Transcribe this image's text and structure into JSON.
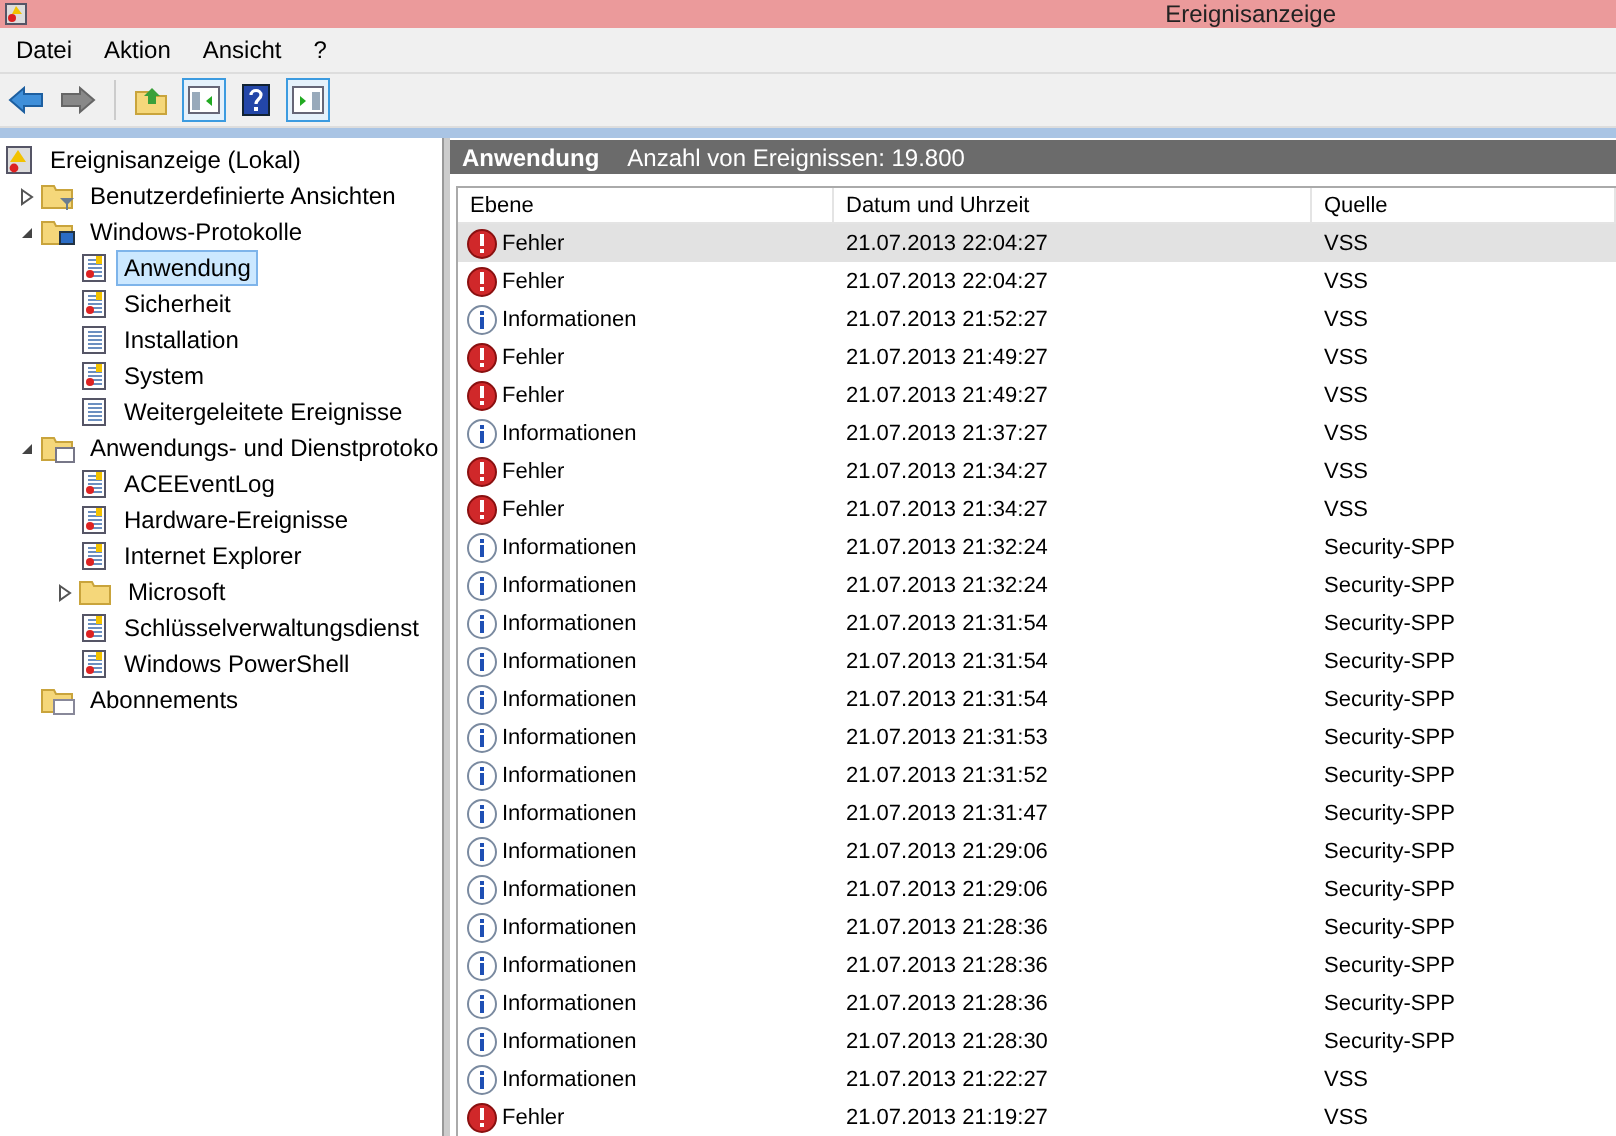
{
  "window": {
    "title": "Ereignisanzeige"
  },
  "menu": [
    "Datei",
    "Aktion",
    "Ansicht",
    "?"
  ],
  "tree": [
    {
      "label": "Ereignisanzeige (Lokal)",
      "kind": "root",
      "selected": false,
      "children": [
        {
          "label": "Benutzerdefinierte Ansichten",
          "kind": "filter-folder",
          "expanded": false,
          "selected": false
        },
        {
          "label": "Windows-Protokolle",
          "kind": "windows-folder",
          "expanded": true,
          "selected": false,
          "children": [
            {
              "label": "Anwendung",
              "kind": "log",
              "selected": true
            },
            {
              "label": "Sicherheit",
              "kind": "log",
              "selected": false
            },
            {
              "label": "Installation",
              "kind": "plain-log",
              "selected": false
            },
            {
              "label": "System",
              "kind": "log",
              "selected": false
            },
            {
              "label": "Weitergeleitete Ereignisse",
              "kind": "plain-log",
              "selected": false
            }
          ]
        },
        {
          "label": "Anwendungs- und Dienstprotoko",
          "kind": "app-folder",
          "expanded": true,
          "selected": false,
          "children": [
            {
              "label": "ACEEventLog",
              "kind": "log",
              "selected": false
            },
            {
              "label": "Hardware-Ereignisse",
              "kind": "log",
              "selected": false
            },
            {
              "label": "Internet Explorer",
              "kind": "log",
              "selected": false
            },
            {
              "label": "Microsoft",
              "kind": "folder",
              "expanded": false,
              "selected": false
            },
            {
              "label": "Schlüsselverwaltungsdienst",
              "kind": "log",
              "selected": false
            },
            {
              "label": "Windows PowerShell",
              "kind": "log",
              "selected": false
            }
          ]
        },
        {
          "label": "Abonnements",
          "kind": "subscriptions",
          "selected": false
        }
      ]
    }
  ],
  "panel": {
    "title": "Anwendung",
    "count": "Anzahl von Ereignissen: 19.800"
  },
  "table": {
    "columns": [
      "Ebene",
      "Datum und Uhrzeit",
      "Quelle"
    ],
    "rows": [
      {
        "kind": "error",
        "level": "Fehler",
        "date": "21.07.2013 22:04:27",
        "source": "VSS",
        "selected": true
      },
      {
        "kind": "error",
        "level": "Fehler",
        "date": "21.07.2013 22:04:27",
        "source": "VSS",
        "selected": false
      },
      {
        "kind": "info",
        "level": "Informationen",
        "date": "21.07.2013 21:52:27",
        "source": "VSS",
        "selected": false
      },
      {
        "kind": "error",
        "level": "Fehler",
        "date": "21.07.2013 21:49:27",
        "source": "VSS",
        "selected": false
      },
      {
        "kind": "error",
        "level": "Fehler",
        "date": "21.07.2013 21:49:27",
        "source": "VSS",
        "selected": false
      },
      {
        "kind": "info",
        "level": "Informationen",
        "date": "21.07.2013 21:37:27",
        "source": "VSS",
        "selected": false
      },
      {
        "kind": "error",
        "level": "Fehler",
        "date": "21.07.2013 21:34:27",
        "source": "VSS",
        "selected": false
      },
      {
        "kind": "error",
        "level": "Fehler",
        "date": "21.07.2013 21:34:27",
        "source": "VSS",
        "selected": false
      },
      {
        "kind": "info",
        "level": "Informationen",
        "date": "21.07.2013 21:32:24",
        "source": "Security-SPP",
        "selected": false
      },
      {
        "kind": "info",
        "level": "Informationen",
        "date": "21.07.2013 21:32:24",
        "source": "Security-SPP",
        "selected": false
      },
      {
        "kind": "info",
        "level": "Informationen",
        "date": "21.07.2013 21:31:54",
        "source": "Security-SPP",
        "selected": false
      },
      {
        "kind": "info",
        "level": "Informationen",
        "date": "21.07.2013 21:31:54",
        "source": "Security-SPP",
        "selected": false
      },
      {
        "kind": "info",
        "level": "Informationen",
        "date": "21.07.2013 21:31:54",
        "source": "Security-SPP",
        "selected": false
      },
      {
        "kind": "info",
        "level": "Informationen",
        "date": "21.07.2013 21:31:53",
        "source": "Security-SPP",
        "selected": false
      },
      {
        "kind": "info",
        "level": "Informationen",
        "date": "21.07.2013 21:31:52",
        "source": "Security-SPP",
        "selected": false
      },
      {
        "kind": "info",
        "level": "Informationen",
        "date": "21.07.2013 21:31:47",
        "source": "Security-SPP",
        "selected": false
      },
      {
        "kind": "info",
        "level": "Informationen",
        "date": "21.07.2013 21:29:06",
        "source": "Security-SPP",
        "selected": false
      },
      {
        "kind": "info",
        "level": "Informationen",
        "date": "21.07.2013 21:29:06",
        "source": "Security-SPP",
        "selected": false
      },
      {
        "kind": "info",
        "level": "Informationen",
        "date": "21.07.2013 21:28:36",
        "source": "Security-SPP",
        "selected": false
      },
      {
        "kind": "info",
        "level": "Informationen",
        "date": "21.07.2013 21:28:36",
        "source": "Security-SPP",
        "selected": false
      },
      {
        "kind": "info",
        "level": "Informationen",
        "date": "21.07.2013 21:28:36",
        "source": "Security-SPP",
        "selected": false
      },
      {
        "kind": "info",
        "level": "Informationen",
        "date": "21.07.2013 21:28:30",
        "source": "Security-SPP",
        "selected": false
      },
      {
        "kind": "info",
        "level": "Informationen",
        "date": "21.07.2013 21:22:27",
        "source": "VSS",
        "selected": false
      },
      {
        "kind": "error",
        "level": "Fehler",
        "date": "21.07.2013 21:19:27",
        "source": "VSS",
        "selected": false
      }
    ]
  }
}
